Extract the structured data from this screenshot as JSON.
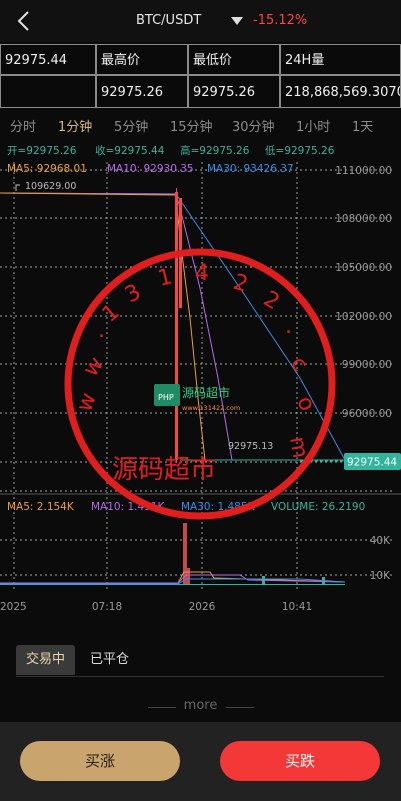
{
  "header": {
    "pair": "BTC/USDT",
    "change": "-15.12%"
  },
  "stats": {
    "last_price": "92975.44",
    "high_label": "最高价",
    "low_label": "最低价",
    "vol_label": "24H量",
    "high_value": "92975.26",
    "low_value": "92975.26",
    "vol_value": "218,868,569.3070"
  },
  "timeframes": [
    "分时",
    "1分钟",
    "5分钟",
    "15分钟",
    "30分钟",
    "1小时",
    "1天"
  ],
  "active_timeframe": "1分钟",
  "ohlc": {
    "open": "开=92975.26",
    "close": "收=92975.44",
    "high": "高=92975.26",
    "low": "低=92975.26"
  },
  "ma": {
    "ma5": "MA5: 92968.01",
    "ma10": "MA10: 92930.35",
    "ma30": "MA30: 93426.37"
  },
  "vol_legend": {
    "ma5": "MA5: 2.154K",
    "ma10": "MA10: 1.491K",
    "ma30": "MA30: 1.485K",
    "volume": "VOLUME: 26.2190"
  },
  "price_axis": [
    "111000.00",
    "108000.00",
    "105000.00",
    "102000.00",
    "99000.00",
    "96000.00"
  ],
  "volume_axis": [
    "40K",
    "10K"
  ],
  "time_axis": [
    "2025",
    "07:18",
    "2026",
    "10:41"
  ],
  "max_marker": "109629.00",
  "min_marker": "92975.13",
  "current_price": "92975.44",
  "watermark": {
    "url": "w w . 1 3 1 4 2 2 . c o m",
    "name": "源码超市",
    "badge_main": "源码超市",
    "badge_sub": "www.131422.com",
    "php": "PHP"
  },
  "order_tabs": [
    "交易中",
    "已平仓"
  ],
  "more": "more",
  "buttons": {
    "buy_up": "买涨",
    "buy_down": "买跌"
  },
  "colors": {
    "gold": "#c9a46c",
    "red": "#f43737",
    "ma5": "#e8a23a",
    "ma10": "#b56ae8",
    "ma30": "#3a8ee8",
    "teal": "#2fb59b"
  },
  "chart_data": {
    "type": "line",
    "series": [
      {
        "name": "MA5",
        "values": [
          109400,
          109400,
          109400,
          109400,
          107800,
          105000,
          99000,
          95100,
          92968
        ]
      },
      {
        "name": "MA10",
        "values": [
          109400,
          109400,
          109400,
          109400,
          108600,
          104600,
          99900,
          95400,
          92930
        ]
      },
      {
        "name": "MA30",
        "values": [
          109400,
          109400,
          109400,
          109400,
          109200,
          103500,
          98000,
          94000,
          93426
        ]
      }
    ],
    "ylim": [
      92000,
      112000
    ]
  }
}
